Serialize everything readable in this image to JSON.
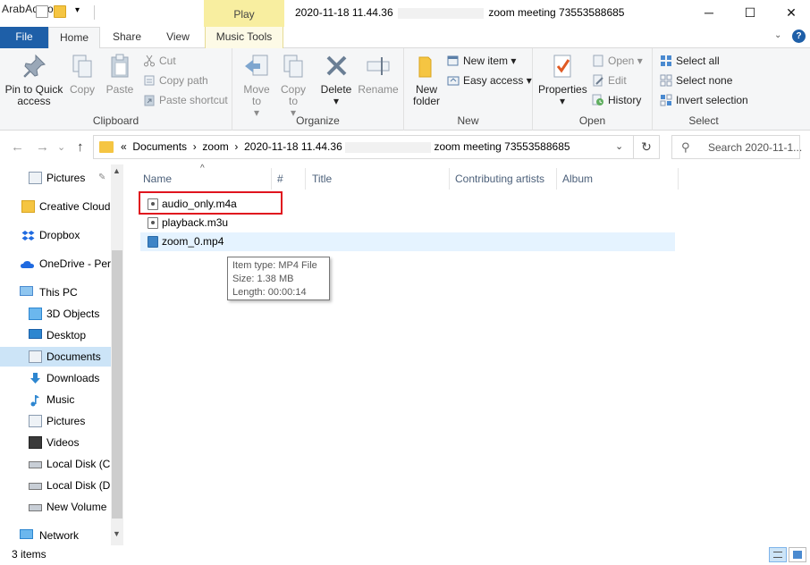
{
  "titlebar": {
    "watermark": "ArabAq.com",
    "context_tab": "Play",
    "title_left": "2020-11-18 11.44.36",
    "title_right": "zoom meeting 73553588685",
    "minimize": "─",
    "maximize": "☐",
    "close": "✕"
  },
  "tabs": {
    "file": "File",
    "home": "Home",
    "share": "Share",
    "view": "View",
    "music_tools": "Music Tools",
    "collapse": "⌄",
    "help": "?"
  },
  "ribbon": {
    "clipboard": {
      "label": "Clipboard",
      "pin": "Pin to Quick access",
      "copy": "Copy",
      "paste": "Paste",
      "cut": "Cut",
      "copy_path": "Copy path",
      "paste_shortcut": "Paste shortcut"
    },
    "organize": {
      "label": "Organize",
      "move_to": "Move to",
      "copy_to": "Copy to",
      "delete": "Delete",
      "rename": "Rename"
    },
    "new": {
      "label": "New",
      "new_folder": "New folder",
      "new_item": "New item",
      "easy_access": "Easy access"
    },
    "open": {
      "label": "Open",
      "properties": "Properties",
      "open": "Open",
      "edit": "Edit",
      "history": "History"
    },
    "select": {
      "label": "Select",
      "select_all": "Select all",
      "select_none": "Select none",
      "invert": "Invert selection"
    }
  },
  "address": {
    "back": "←",
    "forward": "→",
    "recent": "⌄",
    "up": "↑",
    "prefix": "«",
    "path_1": "Documents",
    "path_2": "zoom",
    "path_3": "2020-11-18 11.44.36",
    "path_4": "zoom meeting 73553588685",
    "sep": "›",
    "dropdown": "⌄",
    "refresh": "↻",
    "search_placeholder": "Search 2020-11-1..."
  },
  "navpane": {
    "items": [
      {
        "label": "Pictures"
      },
      {
        "label": "Creative Cloud"
      },
      {
        "label": "Dropbox"
      },
      {
        "label": "OneDrive - Per"
      },
      {
        "label": "This PC"
      },
      {
        "label": "3D Objects"
      },
      {
        "label": "Desktop"
      },
      {
        "label": "Documents"
      },
      {
        "label": "Downloads"
      },
      {
        "label": "Music"
      },
      {
        "label": "Pictures"
      },
      {
        "label": "Videos"
      },
      {
        "label": "Local Disk (C:"
      },
      {
        "label": "Local Disk (D:"
      },
      {
        "label": "New Volume"
      },
      {
        "label": "Network"
      }
    ],
    "pin_glyph": "📌"
  },
  "columns": {
    "name": "Name",
    "number": "#",
    "title": "Title",
    "artists": "Contributing artists",
    "album": "Album",
    "sort_glyph": "^"
  },
  "files": [
    {
      "name": "audio_only.m4a"
    },
    {
      "name": "playback.m3u"
    },
    {
      "name": "zoom_0.mp4"
    }
  ],
  "tooltip": {
    "line1": "Item type: MP4 File",
    "line2": "Size: 1.38 MB",
    "line3": "Length: 00:00:14"
  },
  "status": {
    "count": "3 items"
  },
  "colors": {
    "accent": "#1e5fa8",
    "selection": "#cce4f7",
    "hover": "#e5f3ff",
    "highlight": "#e0141e",
    "folder": "#f5c542"
  }
}
